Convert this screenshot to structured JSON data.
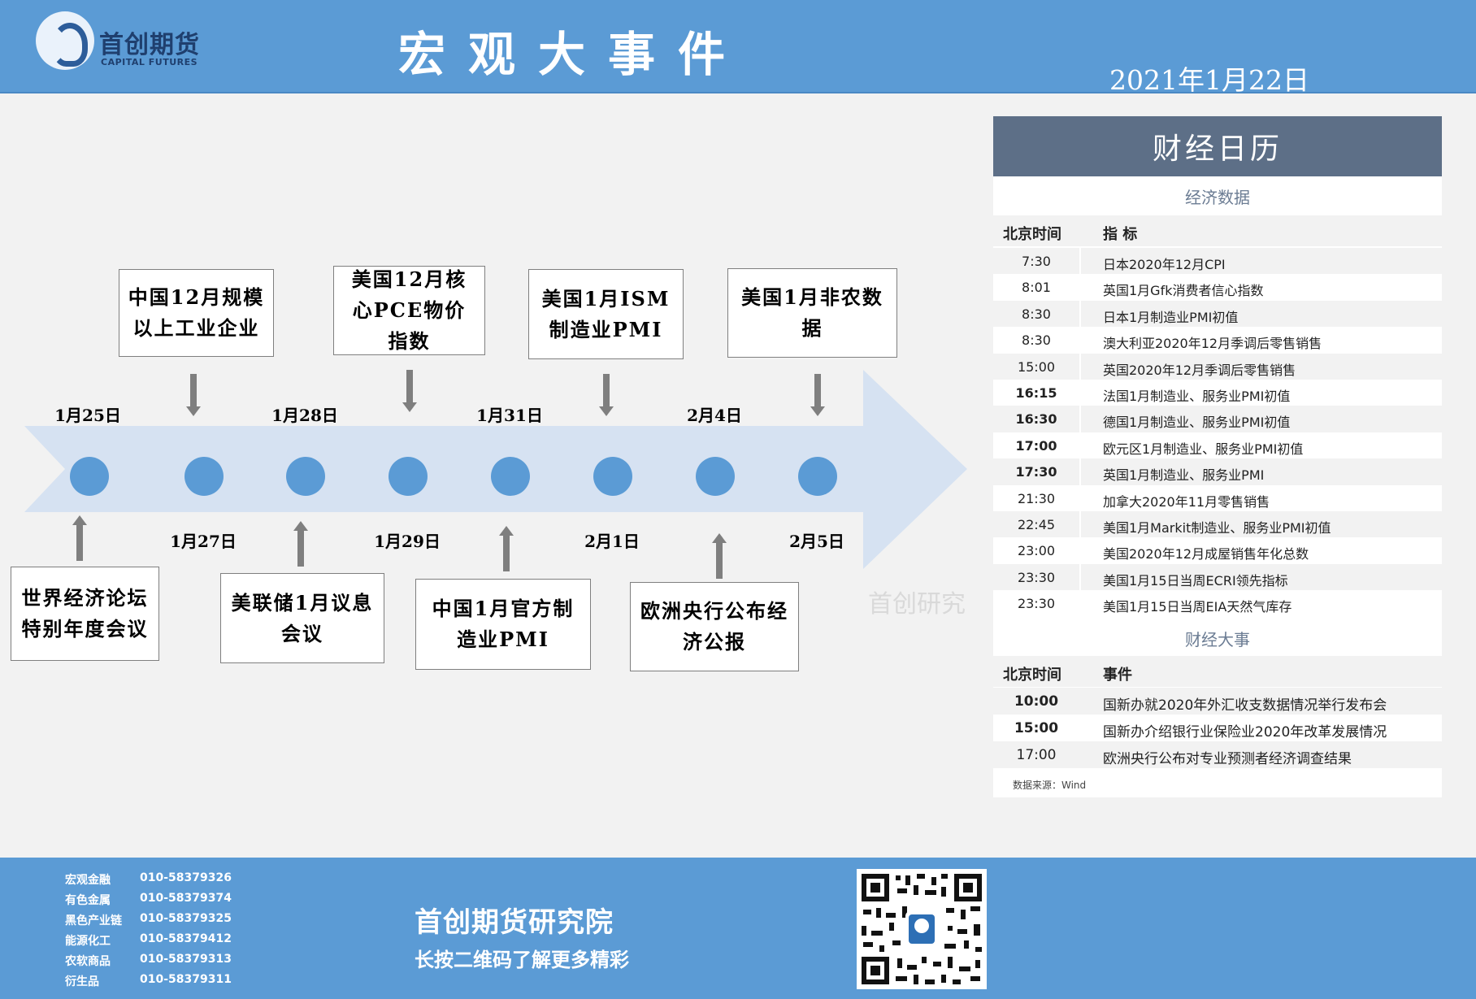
{
  "header": {
    "logo_cn": "首创期货",
    "logo_en": "CAPITAL FUTURES",
    "title": "宏观大事件",
    "date": "2021年1月22日"
  },
  "timeline": {
    "dates_top": [
      "1月25日",
      "1月28日",
      "1月31日",
      "2月4日"
    ],
    "dates_bottom": [
      "1月27日",
      "1月29日",
      "2月1日",
      "2月5日"
    ],
    "events_top": [
      "中国12月规模以上工业企业",
      "美国12月核心PCE物价指数",
      "美国1月ISM制造业PMI",
      "美国1月非农数据"
    ],
    "events_bottom": [
      "世界经济论坛特别年度会议",
      "美联储1月议息会议",
      "中国1月官方制造业PMI",
      "欧洲央行公布经济公报"
    ]
  },
  "watermark": "首创研究",
  "calendar": {
    "title": "财经日历",
    "econ_section": "经济数据",
    "econ_headers": [
      "北京时间",
      "指 标"
    ],
    "econ_rows": [
      {
        "time": "7:30",
        "item": "日本2020年12月CPI",
        "bold": false
      },
      {
        "time": "8:01",
        "item": "英国1月Gfk消费者信心指数",
        "bold": false
      },
      {
        "time": "8:30",
        "item": "日本1月制造业PMI初值",
        "bold": false
      },
      {
        "time": "8:30",
        "item": "澳大利亚2020年12月季调后零售销售",
        "bold": false
      },
      {
        "time": "15:00",
        "item": "英国2020年12月季调后零售销售",
        "bold": false
      },
      {
        "time": "16:15",
        "item": "法国1月制造业、服务业PMI初值",
        "bold": true
      },
      {
        "time": "16:30",
        "item": "德国1月制造业、服务业PMI初值",
        "bold": true
      },
      {
        "time": "17:00",
        "item": "欧元区1月制造业、服务业PMI初值",
        "bold": true
      },
      {
        "time": "17:30",
        "item": "英国1月制造业、服务业PMI",
        "bold": true
      },
      {
        "time": "21:30",
        "item": "加拿大2020年11月零售销售",
        "bold": false
      },
      {
        "time": "22:45",
        "item": "美国1月Markit制造业、服务业PMI初值",
        "bold": false
      },
      {
        "time": "23:00",
        "item": "美国2020年12月成屋销售年化总数",
        "bold": false
      },
      {
        "time": "23:30",
        "item": "美国1月15日当周ECRI领先指标",
        "bold": false
      },
      {
        "time": "23:30",
        "item": "美国1月15日当周EIA天然气库存",
        "bold": false
      }
    ],
    "events_section": "财经大事",
    "events_headers": [
      "北京时间",
      "事件"
    ],
    "event_rows": [
      {
        "time": "10:00",
        "item": "国新办就2020年外汇收支数据情况举行发布会",
        "bold": true
      },
      {
        "time": "15:00",
        "item": "国新办介绍银行业保险业2020年改革发展情况",
        "bold": true
      },
      {
        "time": "17:00",
        "item": "欧洲央行公布对专业预测者经济调查结果",
        "bold": false
      }
    ],
    "source": "数据来源：Wind"
  },
  "footer": {
    "contacts": [
      {
        "label": "宏观金融",
        "phone": "010-58379326"
      },
      {
        "label": "有色金属",
        "phone": "010-58379374"
      },
      {
        "label": "黑色产业链",
        "phone": "010-58379325"
      },
      {
        "label": "能源化工",
        "phone": "010-58379412"
      },
      {
        "label": "农软商品",
        "phone": "010-58379313"
      },
      {
        "label": "衍生品",
        "phone": "010-58379311"
      }
    ],
    "org": "首创期货研究院",
    "tagline": "长按二维码了解更多精彩"
  },
  "colors": {
    "header_bg": "#5b9bd5",
    "calendar_title_bg": "#5d6f87",
    "dot": "#5b9bd5",
    "arrow": "#d6e2f2"
  }
}
